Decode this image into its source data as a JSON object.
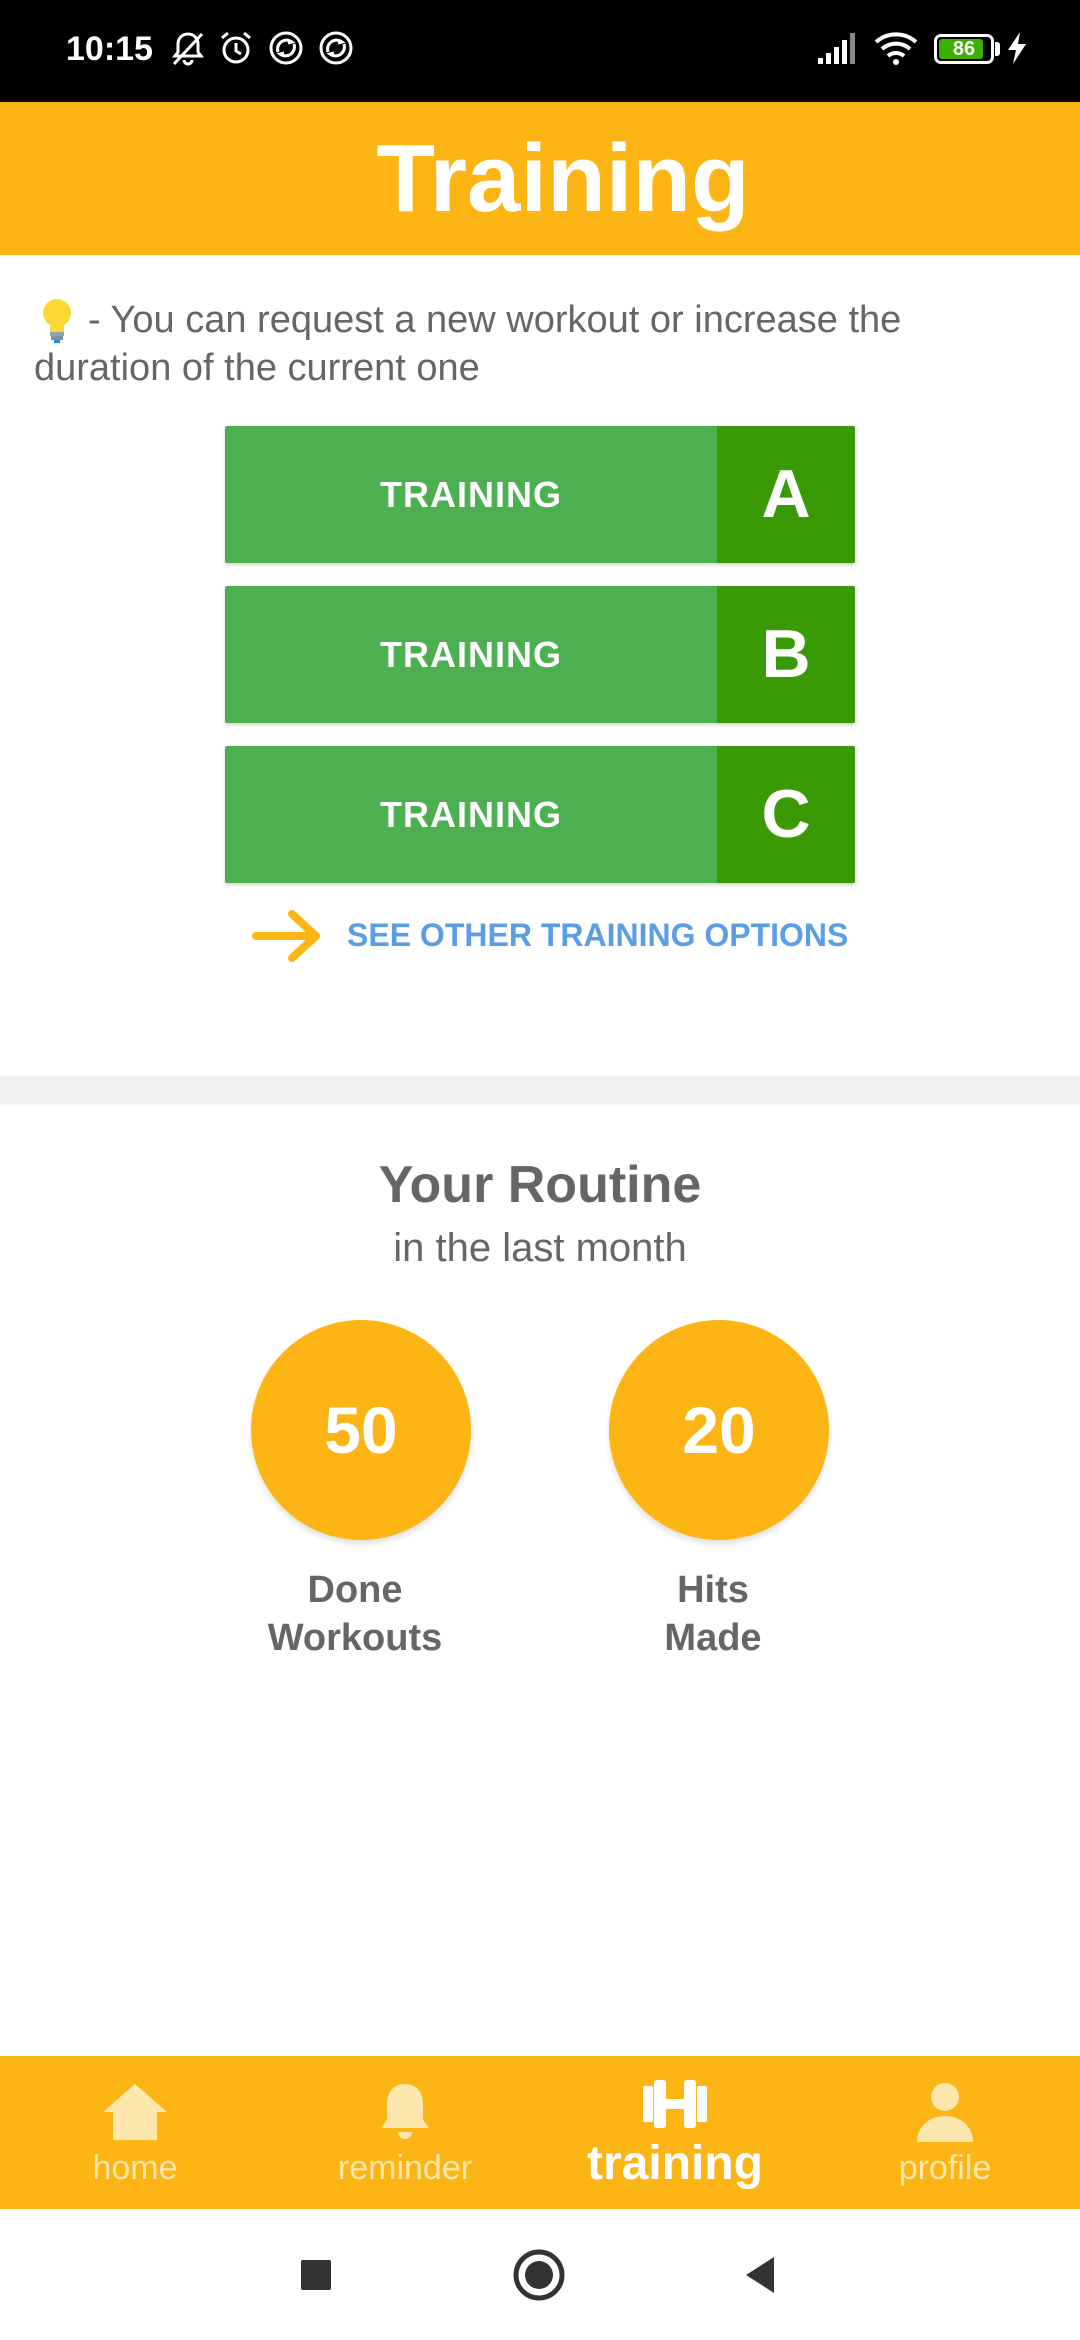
{
  "status_bar": {
    "time": "10:15",
    "battery": "86",
    "icons": [
      "bell-off-icon",
      "alarm-icon",
      "sync-icon",
      "sync-icon",
      "signal-icon",
      "wifi-icon",
      "battery-icon",
      "charging-icon"
    ]
  },
  "header": {
    "title": "Training"
  },
  "tip": {
    "icon": "lightbulb-icon",
    "text": "- You can request a new workout or increase the duration of the current one"
  },
  "trainings": [
    {
      "label": "TRAINING",
      "letter": "A"
    },
    {
      "label": "TRAINING",
      "letter": "B"
    },
    {
      "label": "TRAINING",
      "letter": "C"
    }
  ],
  "see_other": {
    "label": "SEE OTHER TRAINING OPTIONS",
    "icon": "arrow-right-icon"
  },
  "routine": {
    "title": "Your Routine",
    "subtitle": "in the last month",
    "stats": [
      {
        "value": "50",
        "label_line1": "Done",
        "label_line2": "Workouts"
      },
      {
        "value": "20",
        "label_line1": "Hits",
        "label_line2": "Made"
      }
    ]
  },
  "bottom_nav": [
    {
      "label": "home",
      "icon": "home-icon",
      "active": false
    },
    {
      "label": "reminder",
      "icon": "bell-icon",
      "active": false
    },
    {
      "label": "training",
      "icon": "dumbbell-icon",
      "active": true
    },
    {
      "label": "profile",
      "icon": "person-icon",
      "active": false
    }
  ],
  "colors": {
    "brand": "#fdb515",
    "button_green": "#4caf50",
    "letter_green": "#3a9a05",
    "link_blue": "#5c9ee6",
    "text_gray": "#666666"
  }
}
